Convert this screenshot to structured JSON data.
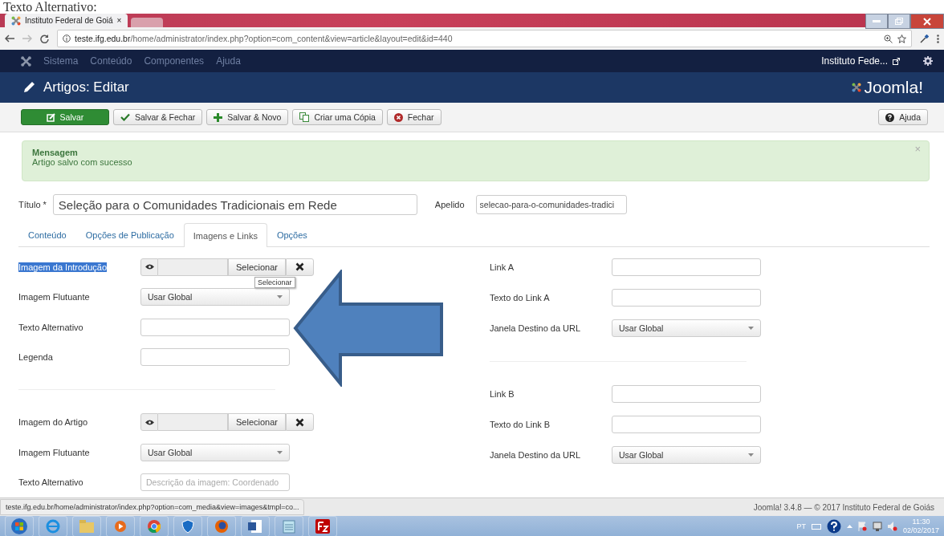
{
  "document_caption": "Texto Alternativo:",
  "browser": {
    "tabs": [
      {
        "title": "Instituto Federal de Goiá",
        "close": "×",
        "selected": true
      },
      {
        "selected": false
      }
    ],
    "address_host": "teste.ifg.edu.br",
    "address_path": "/home/administrator/index.php?option=com_content&view=article&layout=edit&id=440"
  },
  "menu": {
    "items": [
      "Sistema",
      "Conteúdo",
      "Componentes",
      "Ajuda"
    ],
    "site_link": "Instituto Fede..."
  },
  "header": {
    "title": "Artigos: Editar",
    "logo": "Joomla!"
  },
  "toolbar": {
    "buttons": [
      {
        "label": "Salvar",
        "kind": "primary"
      },
      {
        "label": "Salvar & Fechar",
        "kind": "check"
      },
      {
        "label": "Salvar & Novo",
        "kind": "plus"
      },
      {
        "label": "Criar uma Cópia",
        "kind": "copy"
      },
      {
        "label": "Fechar",
        "kind": "close"
      }
    ],
    "help": "Ajuda"
  },
  "message": {
    "heading": "Mensagem",
    "text": "Artigo salvo com sucesso",
    "close": "×"
  },
  "title_field": {
    "label": "Título *",
    "value": "Seleção para o Comunidades Tradicionais em Rede"
  },
  "alias_field": {
    "label": "Apelido",
    "value": "selecao-para-o-comunidades-tradici"
  },
  "tabs": [
    {
      "label": "Conteúdo",
      "selected": false
    },
    {
      "label": "Opções de Publicação",
      "selected": false
    },
    {
      "label": "Imagens e Links",
      "selected": true
    },
    {
      "label": "Opções",
      "selected": false
    }
  ],
  "left_groups": [
    [
      {
        "kind": "media",
        "label": "Imagem da Introdução",
        "highlighted": true,
        "button": "Selecionar",
        "tooltip": "Selecionar"
      },
      {
        "kind": "select",
        "label": "Imagem Flutuante",
        "highlighted": false,
        "value": "Usar Global"
      },
      {
        "kind": "text",
        "label": "Texto Alternativo",
        "highlighted": false
      },
      {
        "kind": "text",
        "label": "Legenda",
        "highlighted": false
      }
    ],
    [
      {
        "kind": "media",
        "label": "Imagem do Artigo",
        "highlighted": false,
        "button": "Selecionar"
      },
      {
        "kind": "select",
        "label": "Imagem Flutuante",
        "highlighted": false,
        "value": "Usar Global"
      },
      {
        "kind": "text",
        "label": "Texto Alternativo",
        "highlighted": false,
        "placeholder": "Descrição da imagem: Coordenado"
      }
    ]
  ],
  "right_groups": [
    [
      {
        "kind": "text",
        "label": "Link A",
        "highlighted": false
      },
      {
        "kind": "text",
        "label": "Texto do Link A",
        "highlighted": false
      },
      {
        "kind": "select",
        "label": "Janela Destino da URL",
        "highlighted": false,
        "value": "Usar Global"
      }
    ],
    [
      {
        "kind": "text",
        "label": "Link B",
        "highlighted": false
      },
      {
        "kind": "text",
        "label": "Texto do Link B",
        "highlighted": false
      },
      {
        "kind": "select",
        "label": "Janela Destino da URL",
        "highlighted": false,
        "value": "Usar Global"
      }
    ]
  ],
  "status_url": "teste.ifg.edu.br/home/administrator/index.php?option=com_media&view=images&tmpl=co...",
  "footer": "Joomla! 3.4.8 — © 2017 Instituto Federal de Goiás",
  "taskbar": {
    "language": "PT",
    "time": "11:30",
    "date": "02/02/2017"
  }
}
